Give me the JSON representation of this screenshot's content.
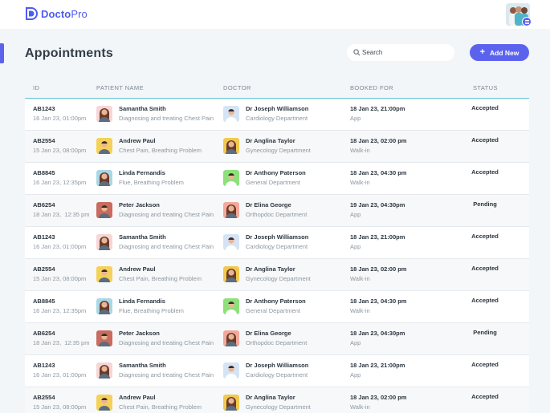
{
  "brand": {
    "name_bold": "Docto",
    "name_thin": "Pro",
    "accent": "#5b63ee"
  },
  "page": {
    "title": "Appointments"
  },
  "search": {
    "placeholder": "Search"
  },
  "actions": {
    "add_label": "Add New"
  },
  "table": {
    "columns": {
      "id": "ID",
      "patient": "PATIENT NAME",
      "doctor": "DOCTOR",
      "booked": "BOOKED FOR",
      "status": "STATUS"
    },
    "rows": [
      {
        "id": "AB1243",
        "created": "16 Jan 23, 01:00pm",
        "patient": "Samantha Smith",
        "reason": "Diagnosing and treating Chest Pain",
        "patient_avatar": "female-red",
        "doctor": "Dr Joseph Williamson",
        "dept": "Cardiology Department",
        "doctor_avatar": "male-blue",
        "booked": "18 Jan 23, 21:00pm",
        "mode": "App",
        "status": "Accepted"
      },
      {
        "id": "AB2554",
        "created": "15 Jan 23, 08:00pm",
        "patient": "Andrew Paul",
        "reason": "Chest Pain, Breathing Problem",
        "patient_avatar": "male-yellow",
        "doctor": "Dr Anglina Taylor",
        "dept": "Gynecology Department",
        "doctor_avatar": "female-yellow",
        "booked": "18 Jan 23, 02:00 pm",
        "mode": "Walk-in",
        "status": "Accepted"
      },
      {
        "id": "AB8845",
        "created": "16 Jan 23, 12:35pm",
        "patient": "Linda Fernandis",
        "reason": "Flue, Breathing Problem",
        "patient_avatar": "female-teal",
        "doctor": "Dr Anthony Paterson",
        "dept": "General Department",
        "doctor_avatar": "male-green",
        "booked": "18 Jan 23, 04:30 pm",
        "mode": "Walk-in",
        "status": "Accepted"
      },
      {
        "id": "AB6254",
        "created": "18 Jan 23,",
        "created2": "12:35 pm",
        "patient": "Peter Jackson",
        "reason": "Diagnosing and treating Chest Pain",
        "patient_avatar": "male-red",
        "doctor": "Dr Elina George",
        "dept": "Orthopdoc Department",
        "doctor_avatar": "female-salmon",
        "booked": "19 Jan 23, 04:30pm",
        "mode": "App",
        "status": "Pending"
      },
      {
        "id": "AB1243",
        "created": "16 Jan 23, 01:00pm",
        "patient": "Samantha Smith",
        "reason": "Diagnosing and treating Chest Pain",
        "patient_avatar": "female-red",
        "doctor": "Dr Joseph Williamson",
        "dept": "Cardiology Department",
        "doctor_avatar": "male-blue",
        "booked": "18 Jan 23, 21:00pm",
        "mode": "App",
        "status": "Accepted"
      },
      {
        "id": "AB2554",
        "created": "15 Jan 23, 08:00pm",
        "patient": "Andrew Paul",
        "reason": "Chest Pain, Breathing Problem",
        "patient_avatar": "male-yellow",
        "doctor": "Dr Anglina Taylor",
        "dept": "Gynecology Department",
        "doctor_avatar": "female-yellow",
        "booked": "18 Jan 23, 02:00 pm",
        "mode": "Walk-in",
        "status": "Accepted"
      },
      {
        "id": "AB8845",
        "created": "16 Jan 23, 12:35pm",
        "patient": "Linda Fernandis",
        "reason": "Flue, Breathing Problem",
        "patient_avatar": "female-teal",
        "doctor": "Dr Anthony Paterson",
        "dept": "General Department",
        "doctor_avatar": "male-green",
        "booked": "18 Jan 23, 04:30 pm",
        "mode": "Walk-in",
        "status": "Accepted"
      },
      {
        "id": "AB6254",
        "created": "18 Jan 23,",
        "created2": "12:35 pm",
        "patient": "Peter Jackson",
        "reason": "Diagnosing and treating Chest Pain",
        "patient_avatar": "male-red",
        "doctor": "Dr Elina George",
        "dept": "Orthopdoc Department",
        "doctor_avatar": "female-salmon",
        "booked": "18 Jan 23, 04:30pm",
        "mode": "App",
        "status": "Pending"
      },
      {
        "id": "AB1243",
        "created": "16 Jan 23, 01:00pm",
        "patient": "Samantha Smith",
        "reason": "Diagnosing and treating Chest Pain",
        "patient_avatar": "female-red",
        "doctor": "Dr Joseph Williamson",
        "dept": "Cardiology Department",
        "doctor_avatar": "male-blue",
        "booked": "18 Jan 23, 21:00pm",
        "mode": "App",
        "status": "Accepted"
      },
      {
        "id": "AB2554",
        "created": "15 Jan 23, 08:00pm",
        "patient": "Andrew Paul",
        "reason": "Chest Pain, Breathing Problem",
        "patient_avatar": "male-yellow",
        "doctor": "Dr Anglina Taylor",
        "dept": "Gynecology Department",
        "doctor_avatar": "female-yellow",
        "booked": "18 Jan 23, 02:00 pm",
        "mode": "Walk-in",
        "status": "Accepted"
      }
    ]
  },
  "avatar_colors": {
    "female-red": "#f7d6d6",
    "male-yellow": "#f5d15a",
    "female-teal": "#a8d8e6",
    "male-red": "#c96b5f",
    "male-blue": "#d5e4f4",
    "female-yellow": "#f2c94c",
    "male-green": "#8ee07a",
    "female-salmon": "#f3a89b"
  }
}
